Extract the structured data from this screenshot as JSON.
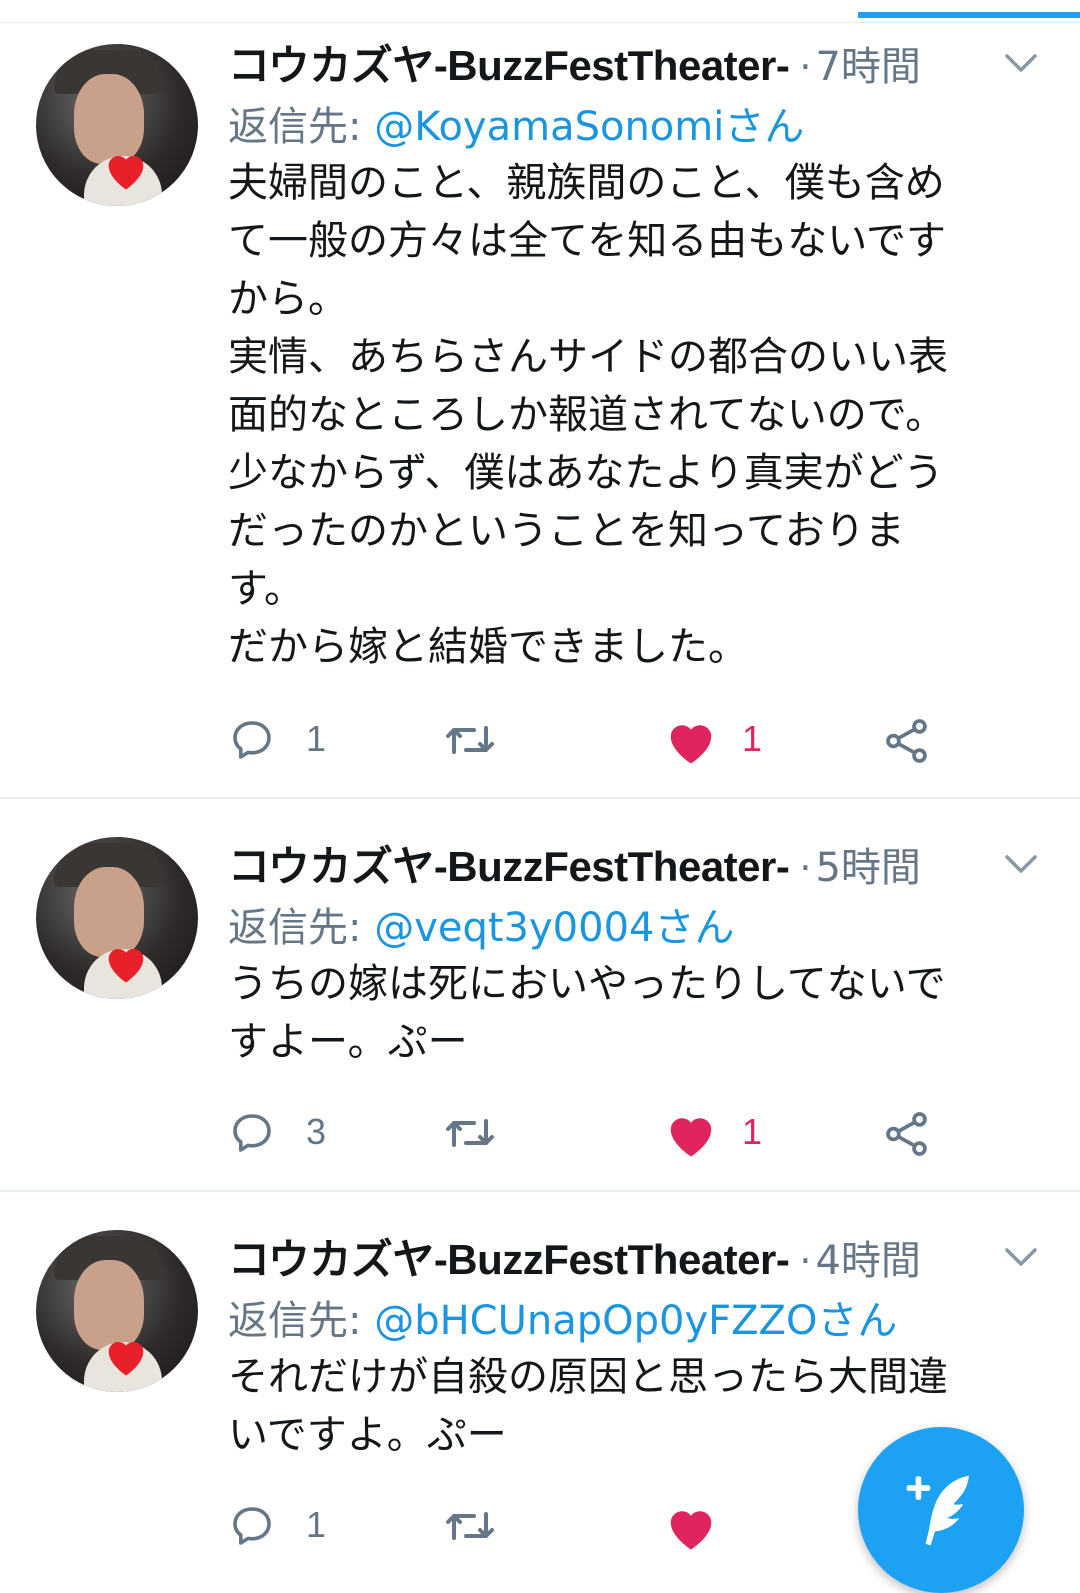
{
  "tweets": [
    {
      "author": "コウカズヤ-BuzzFestTheater-",
      "separator": "·",
      "time": "7時間",
      "reply_prefix": "返信先: ",
      "reply_handle": "@KoyamaSonomiさん",
      "text_lines": [
        "夫婦間のこと、親族間のこと、僕も含め",
        "て一般の方々は全てを知る由もないです",
        "から。",
        "実情、あちらさんサイドの都合のいい表",
        "面的なところしか報道されてないので。",
        "少なからず、僕はあなたより真実がどう",
        "だったのかということを知っておりま",
        "す。",
        "だから嫁と結婚できました。"
      ],
      "reply_count": "1",
      "retweet_count": "",
      "like_count": "1"
    },
    {
      "author": "コウカズヤ-BuzzFestTheater-",
      "separator": "·",
      "time": "5時間",
      "reply_prefix": "返信先: ",
      "reply_handle": "@veqt3y0004さん",
      "text_lines": [
        "うちの嫁は死においやったりしてないで",
        "すよー。ぷー"
      ],
      "reply_count": "3",
      "retweet_count": "",
      "like_count": "1"
    },
    {
      "author": "コウカズヤ-BuzzFestTheater-",
      "separator": "·",
      "time": "4時間",
      "reply_prefix": "返信先: ",
      "reply_handle": "@bHCUnapOp0yFZZOさん",
      "text_lines": [
        "それだけが自殺の原因と思ったら大間違",
        "いですよ。ぷー"
      ],
      "reply_count": "1",
      "retweet_count": "",
      "like_count": ""
    }
  ],
  "colors": {
    "accent": "#1da1f2",
    "handle": "#1b95e0",
    "like": "#e0245e",
    "muted": "#657786"
  },
  "icons": {
    "reply": "speech-bubble-icon",
    "retweet": "retweet-icon",
    "like": "heart-icon",
    "share": "share-icon",
    "menu": "chevron-down-icon",
    "compose": "compose-feather-icon"
  }
}
